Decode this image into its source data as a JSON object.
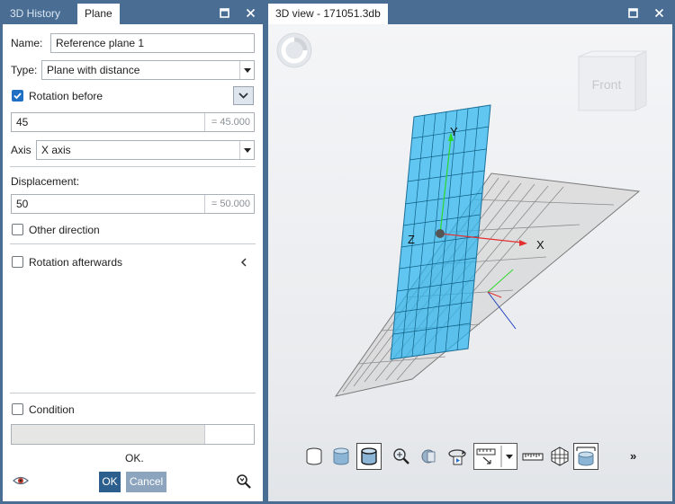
{
  "left_panel": {
    "tabs": [
      "3D History",
      "Plane"
    ],
    "name_label": "Name:",
    "name_value": "Reference plane 1",
    "type_label": "Type:",
    "type_value": "Plane with distance",
    "rotation_before_label": "Rotation before",
    "rotation_value": "45",
    "rotation_result": "= 45.000",
    "axis_label": "Axis",
    "axis_value": "X axis",
    "displacement_label": "Displacement:",
    "displacement_value": "50",
    "displacement_result": "= 50.000",
    "other_direction_label": "Other direction",
    "rotation_afterwards_label": "Rotation afterwards",
    "condition_label": "Condition",
    "status_text": "OK.",
    "ok_label": "OK",
    "cancel_label": "Cancel"
  },
  "right_panel": {
    "title": "3D view - 171051.3db",
    "view_cube_label": "Front",
    "axis_labels": {
      "x": "X",
      "y": "Y",
      "z": "Z"
    },
    "more_label": "»"
  },
  "colors": {
    "accent": "#4a6d94",
    "plane_blue": "#29b6f0",
    "button_blue": "#2d5f8e"
  }
}
